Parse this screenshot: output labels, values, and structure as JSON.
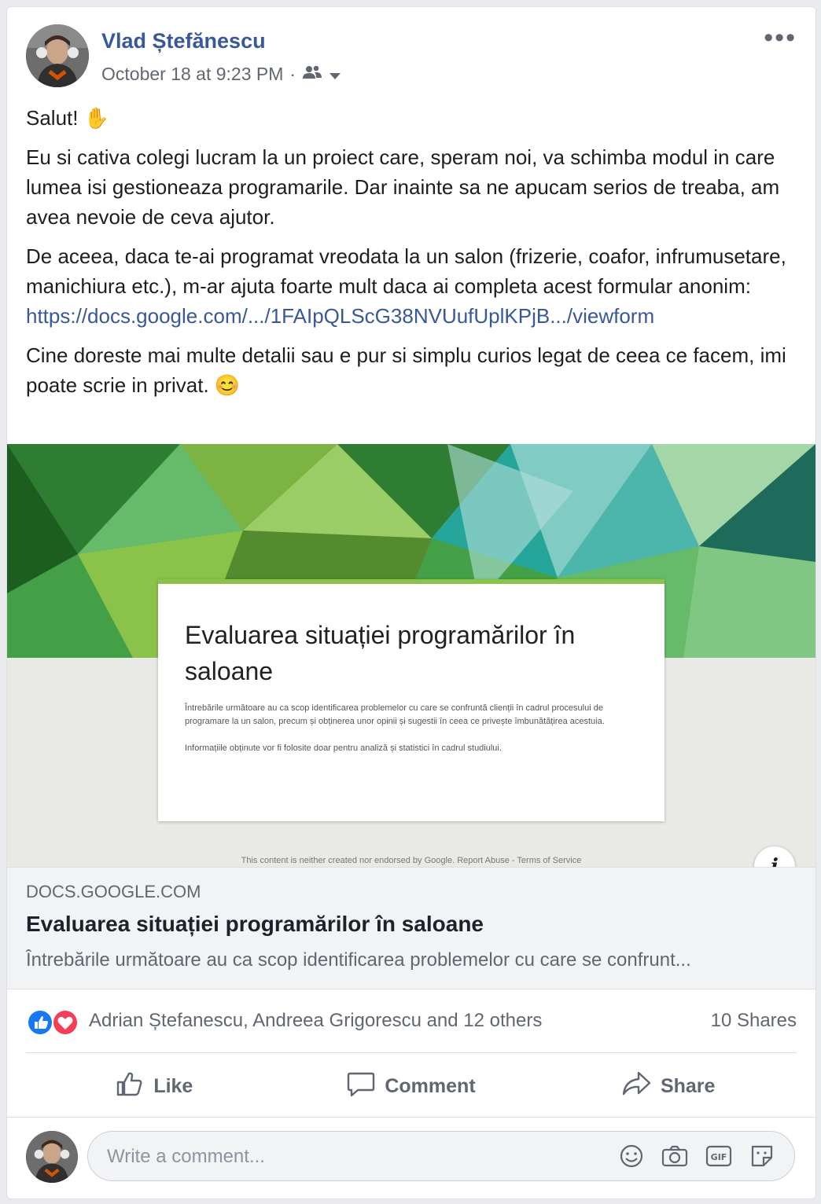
{
  "post": {
    "author": "Vlad Ștefănescu",
    "timestamp": "October 18 at 9:23 PM",
    "separator": "·",
    "more_label": "•••",
    "paragraphs": [
      "Salut! ✋",
      "Eu si cativa colegi lucram la un proiect care, speram noi, va schimba modul in care lumea isi gestioneaza programarile. Dar inainte sa ne apucam serios de treaba, am avea nevoie de ceva ajutor.",
      "De aceea, daca te-ai programat vreodata la un salon (frizerie, coafor, infrumusetare, manichiura etc.), m-ar ajuta foarte mult daca ai completa acest formular anonim:",
      "Cine doreste mai multe detalii sau e pur si simplu curios legat de ceea ce facem, imi poate scrie in privat. 😊"
    ],
    "link_text": "https://docs.google.com/.../1FAIpQLScG38NVUufUplKPjB.../viewform"
  },
  "preview": {
    "form_title": "Evaluarea situației programărilor în saloane",
    "form_desc_1": "Întrebările următoare au ca scop identificarea problemelor cu care se confruntă clienții în cadrul procesului de programare la un salon, precum și obținerea unor opinii și sugestii în ceea ce privește îmbunătățirea acestuia.",
    "form_desc_2": "Informațiile obținute vor fi folosite doar pentru analiză și statistici în cadrul studiului.",
    "disclaimer": "This content is neither created nor endorsed by Google. Report Abuse - Terms of Service",
    "info_label": "i",
    "domain": "DOCS.GOOGLE.COM",
    "title": "Evaluarea situației programărilor în saloane",
    "description": "Întrebările următoare au ca scop identificarea problemelor cu care se confrunt..."
  },
  "reactions": {
    "names": "Adrian Ștefanescu, Andreea Grigorescu and 12 others",
    "shares": "10 Shares"
  },
  "actions": {
    "like": "Like",
    "comment": "Comment",
    "share": "Share"
  },
  "comment_box": {
    "placeholder": "Write a comment..."
  },
  "colors": {
    "link": "#385898",
    "like_blue": "#1877f2",
    "love_red": "#f33e58"
  }
}
